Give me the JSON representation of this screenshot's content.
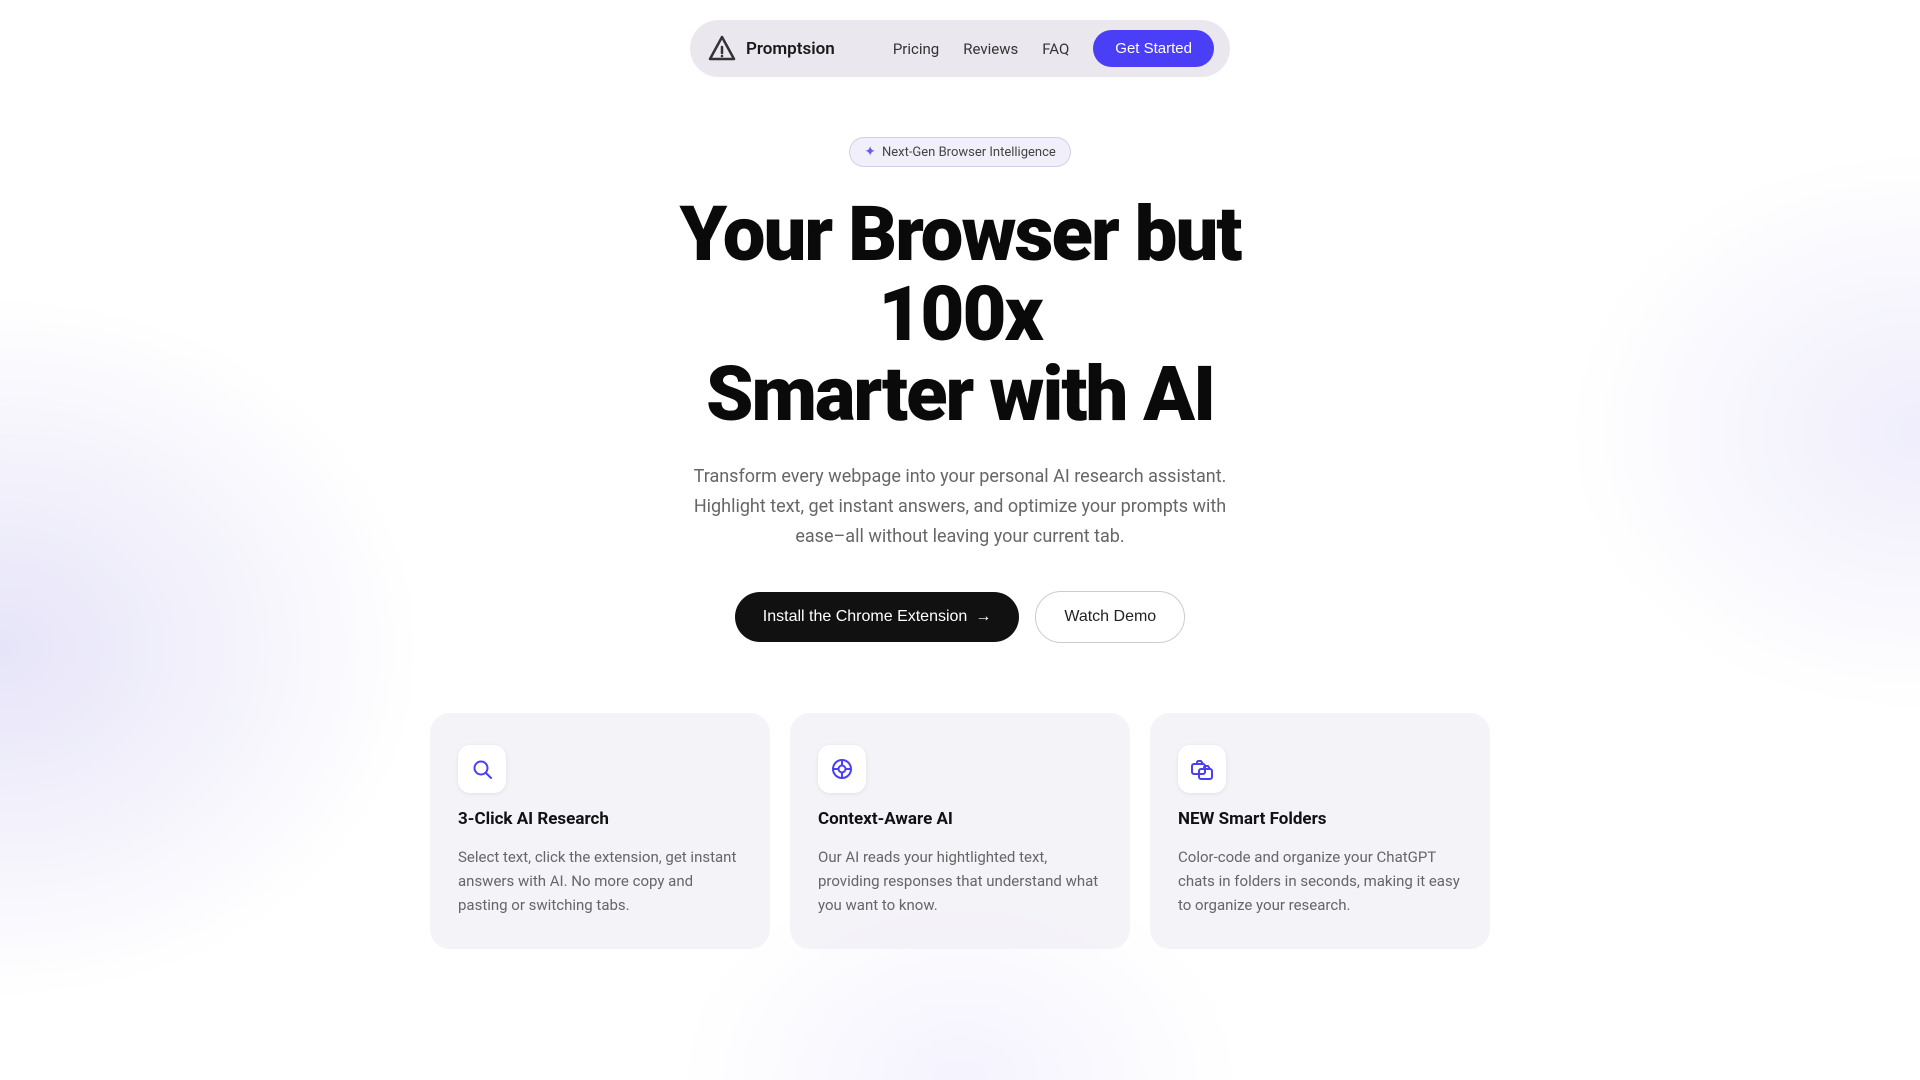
{
  "navbar": {
    "brand_name": "Promptsion",
    "links": [
      {
        "id": "pricing",
        "label": "Pricing"
      },
      {
        "id": "reviews",
        "label": "Reviews"
      },
      {
        "id": "faq",
        "label": "FAQ"
      }
    ],
    "cta_label": "Get Started"
  },
  "hero": {
    "badge_text": "Next-Gen Browser Intelligence",
    "title_line1": "Your Browser but 100x",
    "title_line2": "Smarter with AI",
    "subtitle": "Transform every webpage into your personal AI research assistant. Highlight text, get instant answers, and optimize your prompts with ease–all without leaving your current tab.",
    "install_btn": "Install the Chrome Extension",
    "demo_btn": "Watch Demo"
  },
  "features": [
    {
      "id": "ai-research",
      "icon": "🔍",
      "title": "3-Click AI Research",
      "description": "Select text, click the extension, get instant answers with AI. No more copy and pasting or switching tabs."
    },
    {
      "id": "context-aware",
      "icon": "⊕",
      "title": "Context-Aware AI",
      "description": "Our AI reads your hightlighted text, providing responses that understand what you want to know."
    },
    {
      "id": "smart-folders",
      "icon": "📁",
      "title": "NEW Smart Folders",
      "description": "Color-code and organize your ChatGPT chats in folders in seconds, making it easy to organize your research."
    }
  ]
}
